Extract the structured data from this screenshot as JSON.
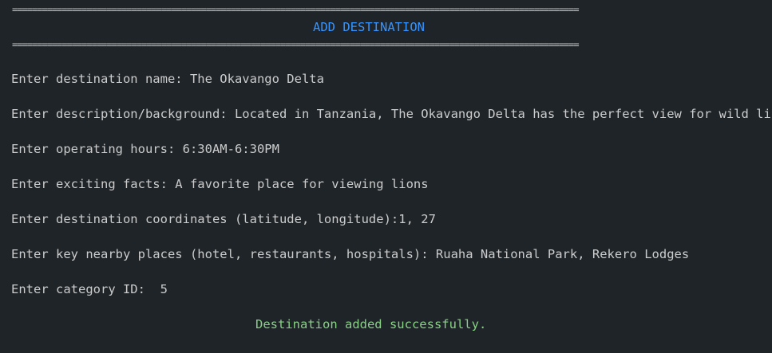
{
  "terminal": {
    "rule_top": "==================================================================================================================",
    "title": "ADD DESTINATION",
    "rule_bottom": "==================================================================================================================",
    "lines": [
      "Enter destination name: The Okavango Delta",
      "Enter description/background: Located in Tanzania, The Okavango Delta has the perfect view for wild life",
      "Enter operating hours: 6:30AM-6:30PM",
      "Enter exciting facts: A favorite place for viewing lions",
      "Enter destination coordinates (latitude, longitude):1, 27",
      "Enter key nearby places (hotel, restaurants, hospitals): Ruaha National Park, Rekero Lodges",
      "Enter category ID:  5"
    ],
    "success_message": "Destination added successfully."
  },
  "colors": {
    "background": "#1f2428",
    "text": "#cccccc",
    "title": "#3794ff",
    "success": "#89d185"
  }
}
